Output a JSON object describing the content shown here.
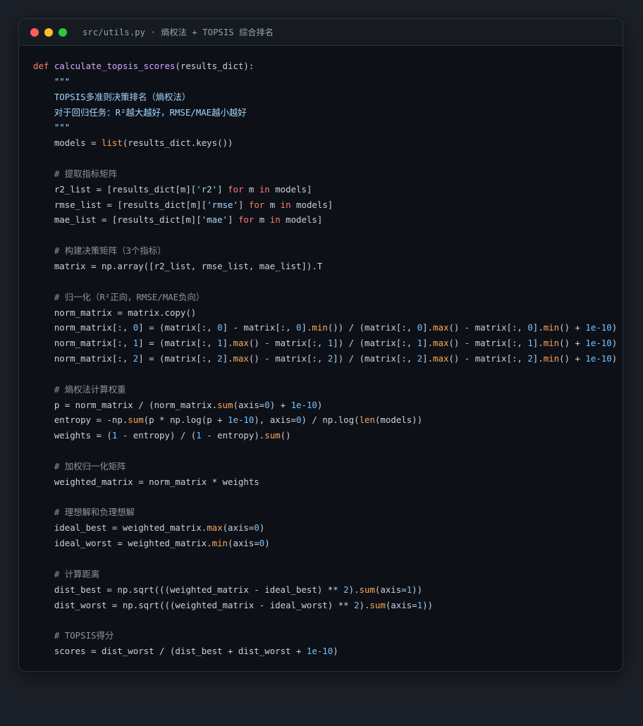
{
  "window": {
    "title": "src/utils.py · 熵权法 + TOPSIS 综合排名",
    "buttons": [
      {
        "name": "close",
        "color": "#ff5f57"
      },
      {
        "name": "minimize",
        "color": "#febc2e"
      },
      {
        "name": "zoom",
        "color": "#28c840"
      }
    ]
  },
  "theme": {
    "keyword": "#ff7b72",
    "function": "#d2a8ff",
    "builtin": "#ffa657",
    "string": "#a5d6ff",
    "number": "#79c0ff",
    "comment": "#8b949e",
    "text": "#c9d1d9"
  },
  "code_lines": [
    [
      [
        "kw",
        "def "
      ],
      [
        "fn",
        "calculate_topsis_scores"
      ],
      [
        "df",
        "(results_dict):"
      ]
    ],
    [
      [
        "st",
        "    \"\"\""
      ]
    ],
    [
      [
        "st",
        "    TOPSIS多准则决策排名（熵权法）"
      ]
    ],
    [
      [
        "st",
        "    对于回归任务：R²越大越好，RMSE/MAE越小越好"
      ]
    ],
    [
      [
        "st",
        "    \"\"\""
      ]
    ],
    [
      [
        "df",
        "    models = "
      ],
      [
        "bi",
        "list"
      ],
      [
        "df",
        "(results_dict.keys())"
      ]
    ],
    [],
    [
      [
        "cm",
        "    # 提取指标矩阵"
      ]
    ],
    [
      [
        "df",
        "    r2_list = [results_dict[m]["
      ],
      [
        "st",
        "'r2'"
      ],
      [
        "df",
        "] "
      ],
      [
        "kw",
        "for"
      ],
      [
        "df",
        " m "
      ],
      [
        "kw",
        "in"
      ],
      [
        "df",
        " models]"
      ]
    ],
    [
      [
        "df",
        "    rmse_list = [results_dict[m]["
      ],
      [
        "st",
        "'rmse'"
      ],
      [
        "df",
        "] "
      ],
      [
        "kw",
        "for"
      ],
      [
        "df",
        " m "
      ],
      [
        "kw",
        "in"
      ],
      [
        "df",
        " models]"
      ]
    ],
    [
      [
        "df",
        "    mae_list = [results_dict[m]["
      ],
      [
        "st",
        "'mae'"
      ],
      [
        "df",
        "] "
      ],
      [
        "kw",
        "for"
      ],
      [
        "df",
        " m "
      ],
      [
        "kw",
        "in"
      ],
      [
        "df",
        " models]"
      ]
    ],
    [],
    [
      [
        "cm",
        "    # 构建决策矩阵（3个指标）"
      ]
    ],
    [
      [
        "df",
        "    matrix = np.array([r2_list, rmse_list, mae_list]).T"
      ]
    ],
    [],
    [
      [
        "cm",
        "    # 归一化（R²正向，RMSE/MAE负向）"
      ]
    ],
    [
      [
        "df",
        "    norm_matrix = matrix.copy()"
      ]
    ],
    [
      [
        "df",
        "    norm_matrix[:, "
      ],
      [
        "nu",
        "0"
      ],
      [
        "df",
        "] = (matrix[:, "
      ],
      [
        "nu",
        "0"
      ],
      [
        "df",
        "] - matrix[:, "
      ],
      [
        "nu",
        "0"
      ],
      [
        "df",
        "]."
      ],
      [
        "bi",
        "min"
      ],
      [
        "df",
        "()) / (matrix[:, "
      ],
      [
        "nu",
        "0"
      ],
      [
        "df",
        "]."
      ],
      [
        "bi",
        "max"
      ],
      [
        "df",
        "() - matrix[:, "
      ],
      [
        "nu",
        "0"
      ],
      [
        "df",
        "]."
      ],
      [
        "bi",
        "min"
      ],
      [
        "df",
        "() + "
      ],
      [
        "nu",
        "1e-10"
      ],
      [
        "df",
        ")"
      ]
    ],
    [
      [
        "df",
        "    norm_matrix[:, "
      ],
      [
        "nu",
        "1"
      ],
      [
        "df",
        "] = (matrix[:, "
      ],
      [
        "nu",
        "1"
      ],
      [
        "df",
        "]."
      ],
      [
        "bi",
        "max"
      ],
      [
        "df",
        "() - matrix[:, "
      ],
      [
        "nu",
        "1"
      ],
      [
        "df",
        "]) / (matrix[:, "
      ],
      [
        "nu",
        "1"
      ],
      [
        "df",
        "]."
      ],
      [
        "bi",
        "max"
      ],
      [
        "df",
        "() - matrix[:, "
      ],
      [
        "nu",
        "1"
      ],
      [
        "df",
        "]."
      ],
      [
        "bi",
        "min"
      ],
      [
        "df",
        "() + "
      ],
      [
        "nu",
        "1e-10"
      ],
      [
        "df",
        ")"
      ]
    ],
    [
      [
        "df",
        "    norm_matrix[:, "
      ],
      [
        "nu",
        "2"
      ],
      [
        "df",
        "] = (matrix[:, "
      ],
      [
        "nu",
        "2"
      ],
      [
        "df",
        "]."
      ],
      [
        "bi",
        "max"
      ],
      [
        "df",
        "() - matrix[:, "
      ],
      [
        "nu",
        "2"
      ],
      [
        "df",
        "]) / (matrix[:, "
      ],
      [
        "nu",
        "2"
      ],
      [
        "df",
        "]."
      ],
      [
        "bi",
        "max"
      ],
      [
        "df",
        "() - matrix[:, "
      ],
      [
        "nu",
        "2"
      ],
      [
        "df",
        "]."
      ],
      [
        "bi",
        "min"
      ],
      [
        "df",
        "() + "
      ],
      [
        "nu",
        "1e-10"
      ],
      [
        "df",
        ")"
      ]
    ],
    [],
    [
      [
        "cm",
        "    # 熵权法计算权重"
      ]
    ],
    [
      [
        "df",
        "    p = norm_matrix / (norm_matrix."
      ],
      [
        "bi",
        "sum"
      ],
      [
        "df",
        "(axis="
      ],
      [
        "nu",
        "0"
      ],
      [
        "df",
        ") + "
      ],
      [
        "nu",
        "1e-10"
      ],
      [
        "df",
        ")"
      ]
    ],
    [
      [
        "df",
        "    entropy = -np."
      ],
      [
        "bi",
        "sum"
      ],
      [
        "df",
        "(p * np.log(p + "
      ],
      [
        "nu",
        "1e-10"
      ],
      [
        "df",
        "), axis="
      ],
      [
        "nu",
        "0"
      ],
      [
        "df",
        ") / np.log("
      ],
      [
        "bi",
        "len"
      ],
      [
        "df",
        "(models))"
      ]
    ],
    [
      [
        "df",
        "    weights = ("
      ],
      [
        "nu",
        "1"
      ],
      [
        "df",
        " - entropy) / ("
      ],
      [
        "nu",
        "1"
      ],
      [
        "df",
        " - entropy)."
      ],
      [
        "bi",
        "sum"
      ],
      [
        "df",
        "()"
      ]
    ],
    [],
    [
      [
        "cm",
        "    # 加权归一化矩阵"
      ]
    ],
    [
      [
        "df",
        "    weighted_matrix = norm_matrix * weights"
      ]
    ],
    [],
    [
      [
        "cm",
        "    # 理想解和负理想解"
      ]
    ],
    [
      [
        "df",
        "    ideal_best = weighted_matrix."
      ],
      [
        "bi",
        "max"
      ],
      [
        "df",
        "(axis="
      ],
      [
        "nu",
        "0"
      ],
      [
        "df",
        ")"
      ]
    ],
    [
      [
        "df",
        "    ideal_worst = weighted_matrix."
      ],
      [
        "bi",
        "min"
      ],
      [
        "df",
        "(axis="
      ],
      [
        "nu",
        "0"
      ],
      [
        "df",
        ")"
      ]
    ],
    [],
    [
      [
        "cm",
        "    # 计算距离"
      ]
    ],
    [
      [
        "df",
        "    dist_best = np.sqrt(((weighted_matrix - ideal_best) ** "
      ],
      [
        "nu",
        "2"
      ],
      [
        "df",
        ")."
      ],
      [
        "bi",
        "sum"
      ],
      [
        "df",
        "(axis="
      ],
      [
        "nu",
        "1"
      ],
      [
        "df",
        "))"
      ]
    ],
    [
      [
        "df",
        "    dist_worst = np.sqrt(((weighted_matrix - ideal_worst) ** "
      ],
      [
        "nu",
        "2"
      ],
      [
        "df",
        ")."
      ],
      [
        "bi",
        "sum"
      ],
      [
        "df",
        "(axis="
      ],
      [
        "nu",
        "1"
      ],
      [
        "df",
        "))"
      ]
    ],
    [],
    [
      [
        "cm",
        "    # TOPSIS得分"
      ]
    ],
    [
      [
        "df",
        "    scores = dist_worst / (dist_best + dist_worst + "
      ],
      [
        "nu",
        "1e-10"
      ],
      [
        "df",
        ")"
      ]
    ]
  ]
}
